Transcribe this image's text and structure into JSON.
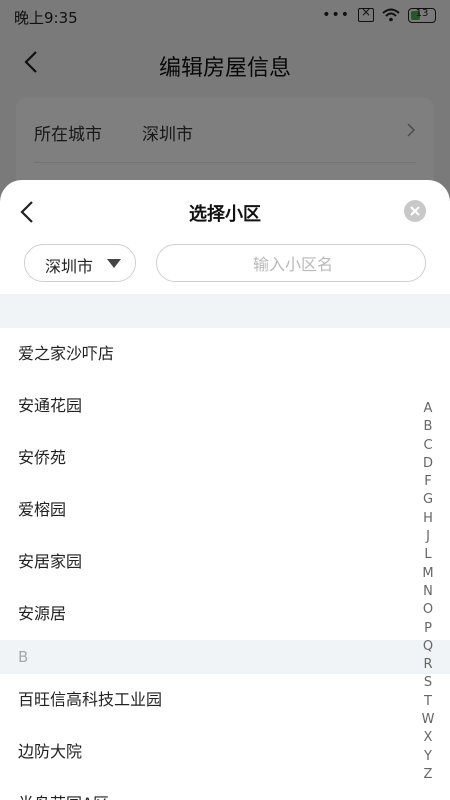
{
  "status_bar": {
    "time": "晚上9:35",
    "dots": "•••",
    "battery": "13"
  },
  "background_page": {
    "title": "编辑房屋信息",
    "city_row": {
      "label": "所在城市",
      "value": "深圳市"
    }
  },
  "sheet": {
    "title": "选择小区",
    "city_select": {
      "value": "深圳市"
    },
    "search": {
      "placeholder": "输入小区名"
    },
    "sections": [
      {
        "header": "",
        "items": [
          "爱之家沙吓店",
          "安通花园",
          "安侨苑",
          "爱榕园",
          "安居家园",
          "安源居"
        ]
      },
      {
        "header": "B",
        "items": [
          "百旺信高科技工业园",
          "边防大院",
          "半岛花园A区"
        ]
      }
    ],
    "alphabet": [
      "A",
      "B",
      "C",
      "D",
      "F",
      "G",
      "H",
      "J",
      "L",
      "M",
      "N",
      "O",
      "P",
      "Q",
      "R",
      "S",
      "T",
      "W",
      "X",
      "Y",
      "Z"
    ]
  }
}
